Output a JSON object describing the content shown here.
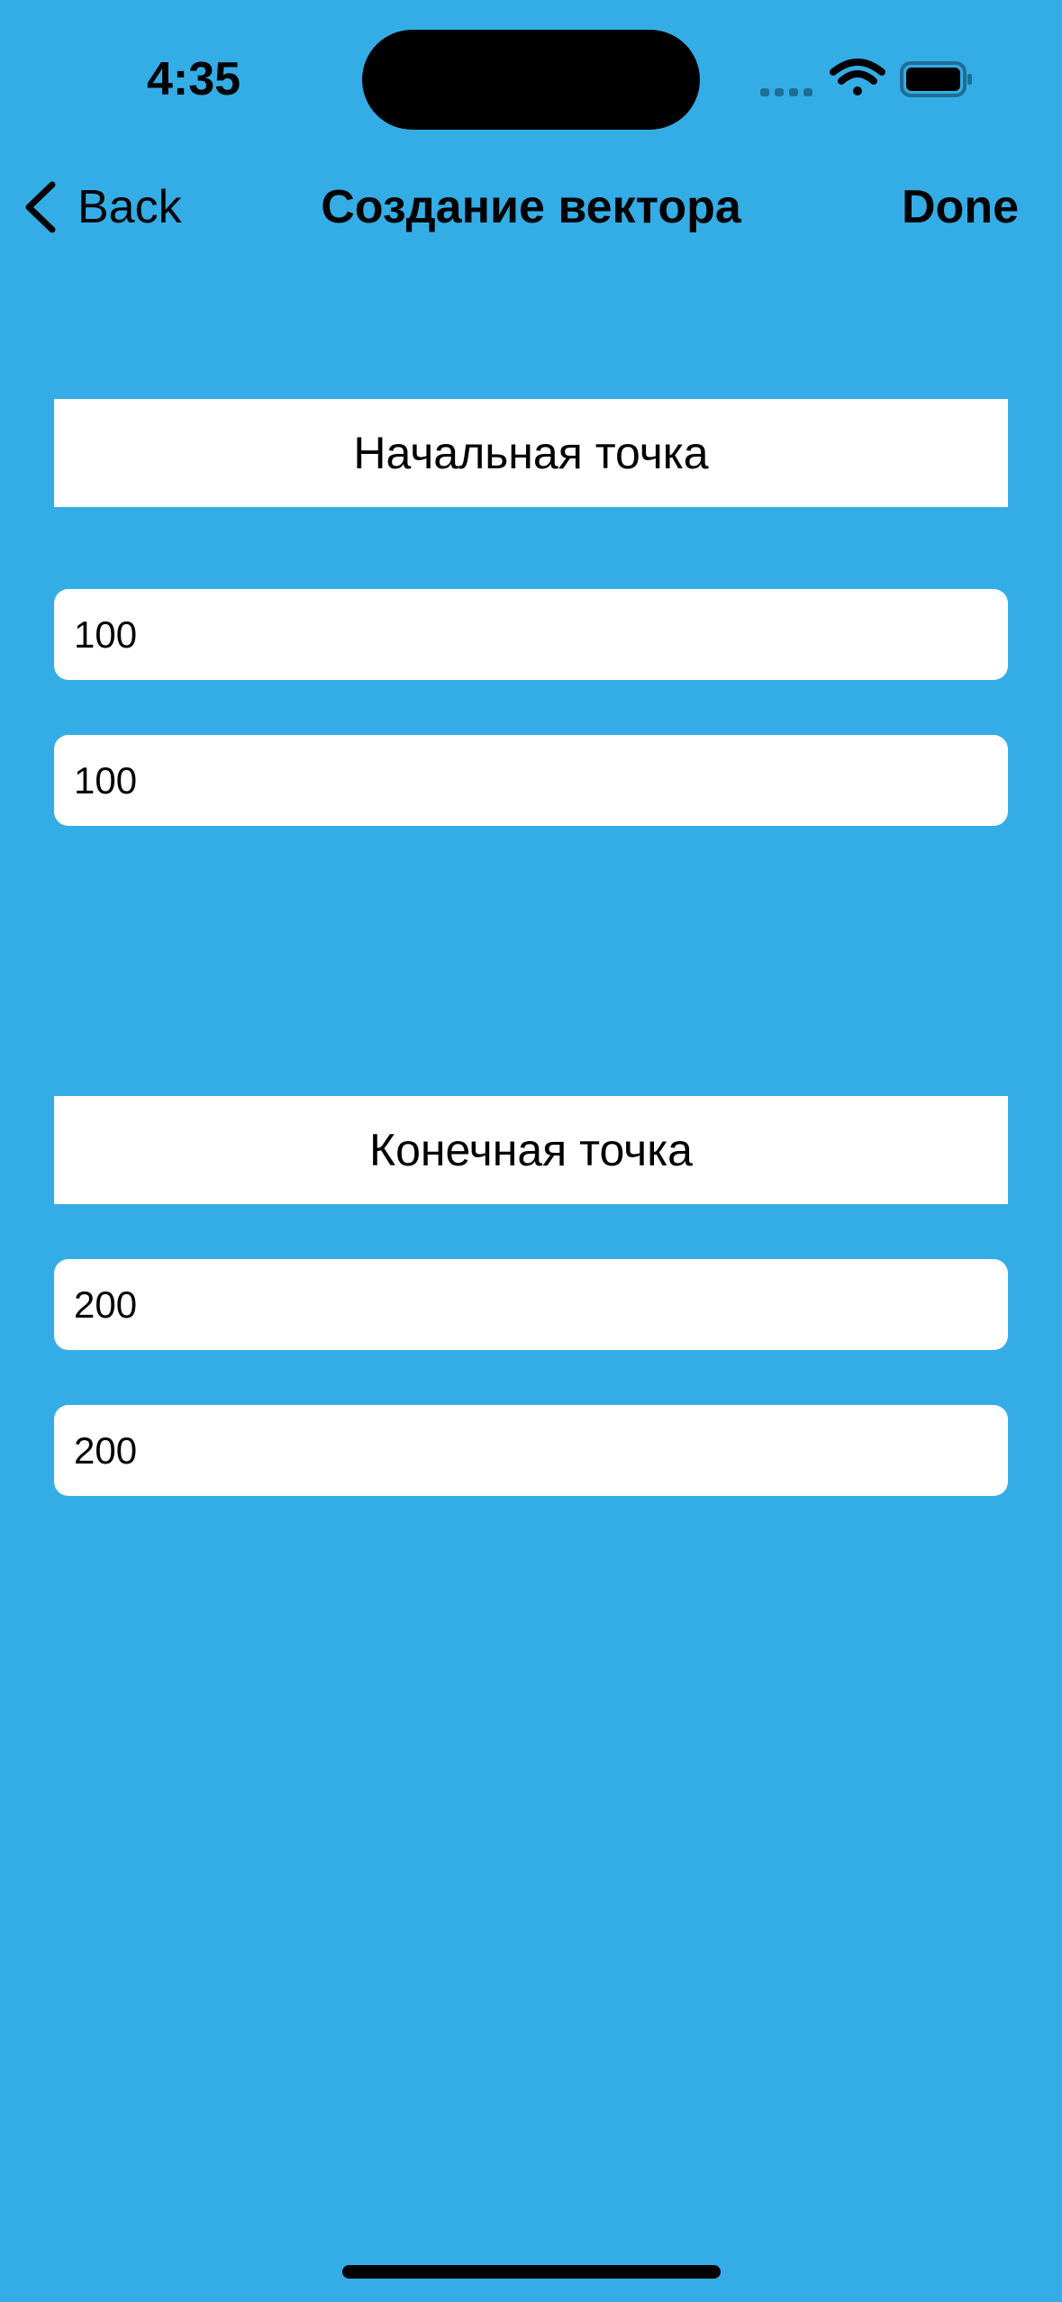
{
  "status_bar": {
    "time": "4:35",
    "icons": [
      "cellular-signal-icon",
      "wifi-icon",
      "battery-icon"
    ]
  },
  "nav_bar": {
    "back_label": "Back",
    "title": "Создание вектора",
    "done_label": "Done"
  },
  "start_point": {
    "header": "Начальная точка",
    "x_value": "100",
    "y_value": "100"
  },
  "end_point": {
    "header": "Конечная точка",
    "x_value": "200",
    "y_value": "200"
  },
  "colors": {
    "background": "#34ADE6",
    "field_background": "#FFFFFF",
    "text": "#000000"
  }
}
